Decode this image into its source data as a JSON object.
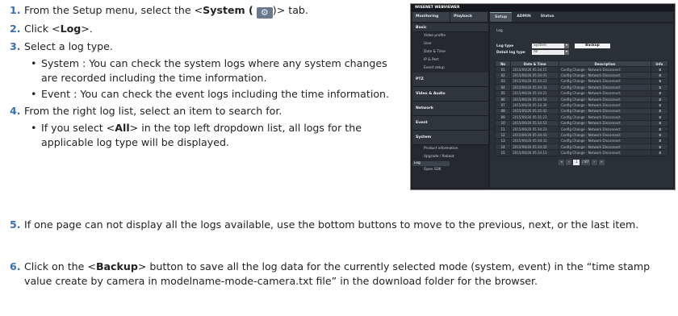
{
  "steps": {
    "s1": {
      "num": "1.",
      "pre": "From the Setup menu, select the <",
      "bold": "System (",
      "post": ")> tab."
    },
    "s2": {
      "num": "2.",
      "pre": "Click <",
      "bold": "Log",
      "post": ">."
    },
    "s3": {
      "num": "3.",
      "text": "Select a log type."
    },
    "b1": "System : You can check the system logs where any system changes are recorded including the time information.",
    "b2": "Event : You can check the event logs including the time information.",
    "s4": {
      "num": "4.",
      "text": "From the right log list, select an item to search for."
    },
    "b3": {
      "pre": "If you select <",
      "bold": "All",
      "post": "> in the top left dropdown list, all logs for the applicable log type will be displayed."
    },
    "s5": {
      "num": "5.",
      "text": "If one page can not display all the logs available, use the bottom buttons to move to the previous, next, or the last item."
    },
    "s6": {
      "num": "6.",
      "pre": "Click on the <",
      "bold": "Backup",
      "post": "> button to save all the log data for the currently selected mode (system, event) in the “time stamp value create by camera in modelname-mode-camera.txt file” in the download folder for the browser."
    },
    "bullet": "•"
  },
  "shot": {
    "brand": "WISENET WEBVIEWER",
    "topnav": [
      "Monitoring",
      "Playback"
    ],
    "tabs": [
      "Setup",
      "ADMIN",
      "Status"
    ],
    "sidebar": {
      "basic": "Basic",
      "basic_items": [
        "Video profile",
        "User",
        "Date & Time",
        "IP & Port",
        "Event setup"
      ],
      "ptz": "PTZ",
      "video": "Video & Audio",
      "network": "Network",
      "event": "Event",
      "system": "System",
      "system_items": [
        "Product information",
        "Upgrade / Reboot",
        "Log",
        "Open SDK"
      ]
    },
    "log_title": "Log",
    "log_type_label": "Log type",
    "log_type_value": "System",
    "detail_label": "Detail log type",
    "detail_value": "All",
    "backup": "Backup",
    "cols": [
      "No",
      "Date & Time",
      "Description",
      "Info"
    ],
    "rows": [
      {
        "no": "01",
        "dt": "2015/06/26 05:34:15",
        "desc": "Config Change - Network Disconnect"
      },
      {
        "no": "02",
        "dt": "2015/06/26 05:34:41",
        "desc": "Config Change - Network Disconnect"
      },
      {
        "no": "03",
        "dt": "2015/06/26 05:34:23",
        "desc": "Config Change - Network Disconnect"
      },
      {
        "no": "04",
        "dt": "2015/06/26 05:34:33",
        "desc": "Config Change - Network Disconnect"
      },
      {
        "no": "05",
        "dt": "2015/06/26 05:34:21",
        "desc": "Config Change - Network Disconnect"
      },
      {
        "no": "06",
        "dt": "2015/06/26 05:34:54",
        "desc": "Config Change - Network Disconnect"
      },
      {
        "no": "07",
        "dt": "2015/06/26 05:34:30",
        "desc": "Config Change - Network Disconnect"
      },
      {
        "no": "08",
        "dt": "2015/06/26 05:35:42",
        "desc": "Config Change - Network Disconnect"
      },
      {
        "no": "09",
        "dt": "2015/06/26 05:35:23",
        "desc": "Config Change - Network Disconnect"
      },
      {
        "no": "10",
        "dt": "2015/06/26 05:34:53",
        "desc": "Config Change - Network Disconnect"
      },
      {
        "no": "11",
        "dt": "2015/06/26 05:34:23",
        "desc": "Config Change - Network Disconnect"
      },
      {
        "no": "12",
        "dt": "2015/06/26 05:34:41",
        "desc": "Config Change - Network Disconnect"
      },
      {
        "no": "13",
        "dt": "2015/06/26 05:34:33",
        "desc": "Config Change - Network Disconnect"
      },
      {
        "no": "14",
        "dt": "2015/06/26 05:34:20",
        "desc": "Config Change - Network Disconnect"
      },
      {
        "no": "15",
        "dt": "2015/06/26 05:34:13",
        "desc": "Config Change - Network Disconnect"
      }
    ],
    "info_glyph": "⌹",
    "pager": {
      "first": "«",
      "prev": "‹",
      "page": "1",
      "total": "/ 87",
      "next": "›",
      "last": "»"
    },
    "gear_glyph": "⚙",
    "arrow": "▸",
    "dropdown_glyph": "▾"
  }
}
